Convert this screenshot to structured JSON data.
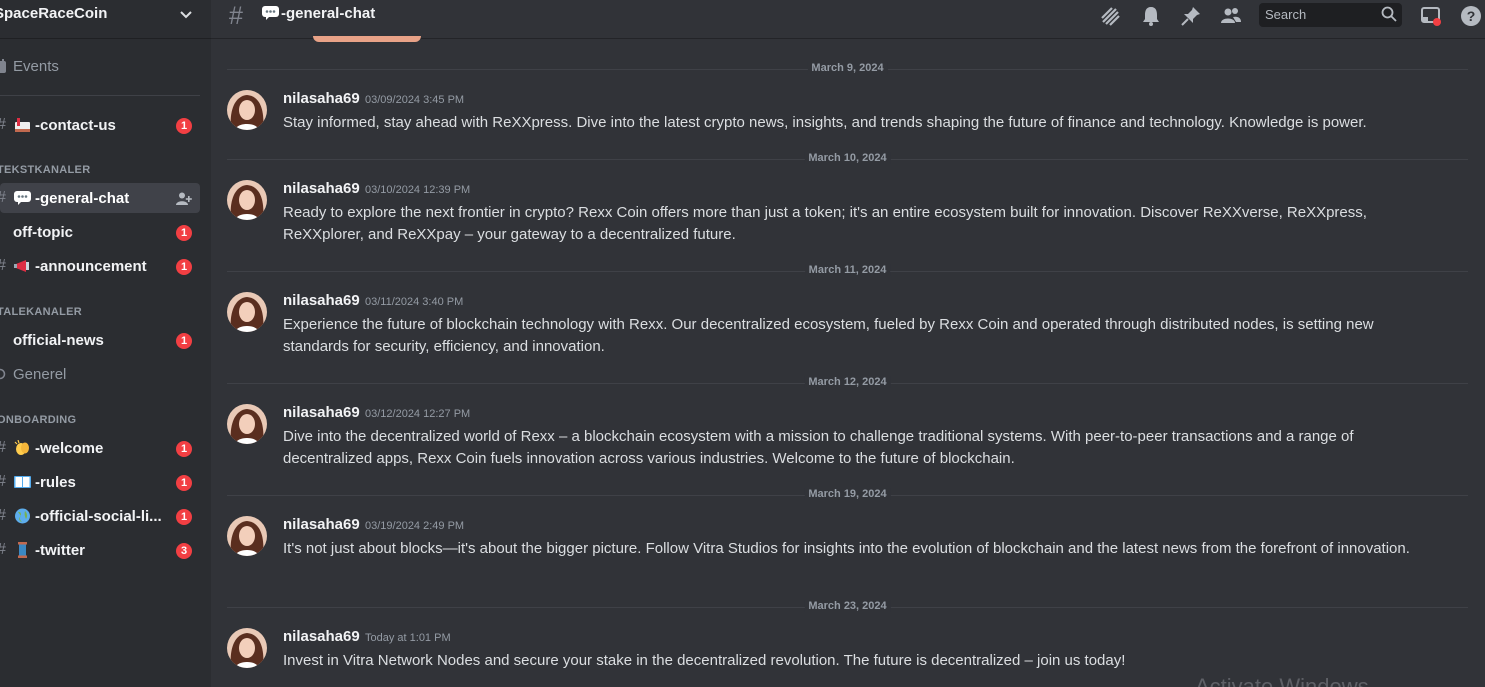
{
  "server": {
    "name": "SpaceRaceCoin"
  },
  "sidebar": {
    "events_label": "Events",
    "categories": [
      "TEKSTKANALER",
      "TALEKANALER",
      "ONBOARDING"
    ],
    "channels": [
      {
        "label": "-contact-us",
        "badge": "1",
        "emoji": "mailbox"
      },
      {
        "label": "-general-chat",
        "emoji": "speech-balloon"
      },
      {
        "label": "off-topic",
        "badge": "1"
      },
      {
        "label": "-announcement",
        "badge": "1",
        "emoji": "megaphone"
      },
      {
        "label": "official-news",
        "badge": "1"
      },
      {
        "label": "Generel"
      },
      {
        "label": "-welcome",
        "badge": "1",
        "emoji": "clapping-hands"
      },
      {
        "label": "-rules",
        "badge": "1",
        "emoji": "open-book"
      },
      {
        "label": "-official-social-li...",
        "badge": "1",
        "emoji": "globe"
      },
      {
        "label": "-twitter",
        "badge": "3",
        "emoji": "thread"
      }
    ]
  },
  "header": {
    "channel_title": "-general-chat",
    "search_placeholder": "Search",
    "icons": [
      "threads-icon",
      "bell-icon",
      "pin-icon",
      "members-icon",
      "search-icon",
      "inbox-icon",
      "help-icon"
    ]
  },
  "messages": [
    {
      "date": "March 9, 2024",
      "author": "nilasaha69",
      "timestamp": "03/09/2024 3:45 PM",
      "text": "Stay informed, stay ahead with ReXXpress. Dive into the latest crypto news, insights, and trends shaping the future of finance and technology. Knowledge is power."
    },
    {
      "date": "March 10, 2024",
      "author": "nilasaha69",
      "timestamp": "03/10/2024 12:39 PM",
      "text": "Ready to explore the next frontier in crypto? Rexx Coin offers more than just a token; it's an entire ecosystem built for innovation. Discover ReXXverse, ReXXpress, ReXXplorer, and ReXXpay – your gateway to a decentralized future."
    },
    {
      "date": "March 11, 2024",
      "author": "nilasaha69",
      "timestamp": "03/11/2024 3:40 PM",
      "text": "Experience the future of blockchain technology with Rexx. Our decentralized ecosystem, fueled by Rexx Coin and operated through distributed nodes, is setting new standards for security, efficiency, and innovation."
    },
    {
      "date": "March 12, 2024",
      "author": "nilasaha69",
      "timestamp": "03/12/2024 12:27 PM",
      "text": "Dive into the decentralized world of Rexx – a blockchain ecosystem with a mission to challenge traditional systems. With peer-to-peer transactions and a range of decentralized apps, Rexx Coin fuels innovation across various industries. Welcome to the future of blockchain."
    },
    {
      "date": "March 19, 2024",
      "author": "nilasaha69",
      "timestamp": "03/19/2024 2:49 PM",
      "text": "It's not just about blocks—it's about the bigger picture. Follow Vitra Studios for insights into the evolution of blockchain and the latest news from the forefront of innovation."
    },
    {
      "date": "March 23, 2024",
      "author": "nilasaha69",
      "timestamp": "Today at 1:01 PM",
      "text": "Invest in Vitra Network Nodes and secure your stake in the decentralized revolution. The future is decentralized – join us today!"
    }
  ],
  "watermark": "Activate Windows"
}
